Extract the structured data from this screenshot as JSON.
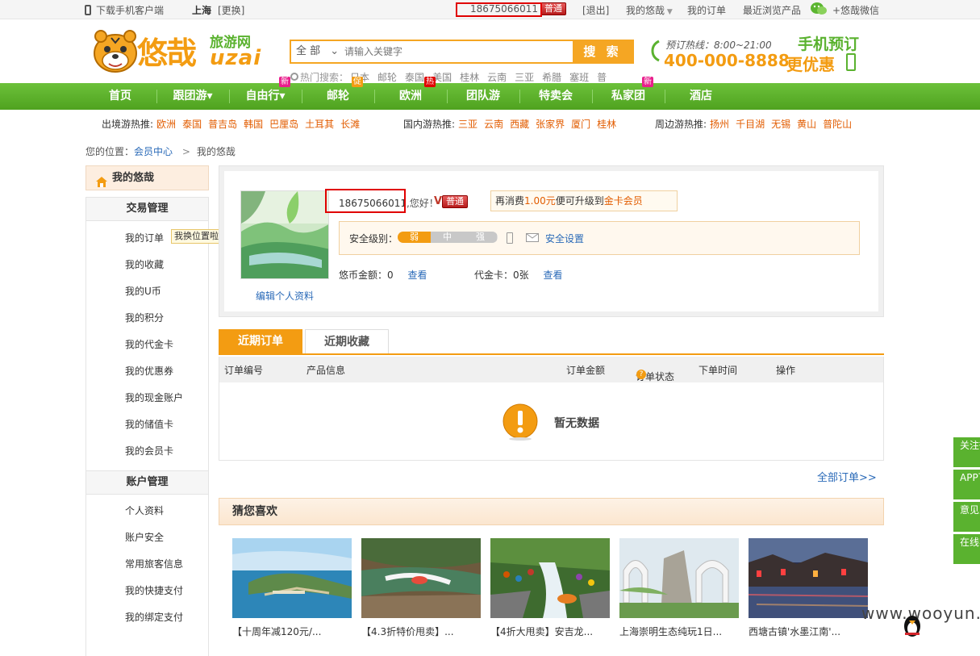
{
  "topbar": {
    "download_app": "下载手机客户端",
    "city": "上海",
    "change_city": "[更换]",
    "username": "18675066011",
    "vip_level": "普通",
    "logout": "[退出]",
    "my_uzai": "我的悠哉",
    "my_orders": "我的订单",
    "recent_viewed": "最近浏览产品",
    "wechat": "+悠哉微信"
  },
  "logo": {
    "cn_name": "悠哉",
    "sub": "旅游网",
    "en": "uzai"
  },
  "search": {
    "category": "全 部",
    "placeholder": "请输入关键字",
    "button": "搜 索",
    "hot_label": "热门搜索：",
    "hot_items": [
      "日本",
      "邮轮",
      "泰国",
      "美国",
      "桂林",
      "云南",
      "三亚",
      "希腊",
      "塞班",
      "普"
    ]
  },
  "hotline": {
    "label": "预订热线：8:00~21:00",
    "number": "400-000-8888"
  },
  "mobile_ad": {
    "line1": "手机预订",
    "line2": "更优惠"
  },
  "nav": {
    "items": [
      {
        "label": "首页"
      },
      {
        "label": "跟团游▾"
      },
      {
        "label": "自由行▾",
        "tag": "新"
      },
      {
        "label": "邮轮",
        "tag": "促"
      },
      {
        "label": "欧洲",
        "tag": "热"
      },
      {
        "label": "团队游"
      },
      {
        "label": "特卖会"
      },
      {
        "label": "私家团",
        "tag": "新"
      },
      {
        "label": "酒店"
      }
    ]
  },
  "recommend": {
    "outbound_label": "出境游热推:",
    "outbound": [
      "欧洲",
      "泰国",
      "普吉岛",
      "韩国",
      "巴厘岛",
      "土耳其",
      "长滩"
    ],
    "domestic_label": "国内游热推:",
    "domestic": [
      "三亚",
      "云南",
      "西藏",
      "张家界",
      "厦门",
      "桂林"
    ],
    "nearby_label": "周边游热推:",
    "nearby": [
      "扬州",
      "千目湖",
      "无锡",
      "黄山",
      "普陀山"
    ]
  },
  "breadcrumb": {
    "prefix": "您的位置：",
    "level1": "会员中心",
    "sep": ">",
    "current": "我的悠哉"
  },
  "sidebar": {
    "home": "我的悠哉",
    "trade_title": "交易管理",
    "trade_items": [
      "我的订单",
      "我的收藏",
      "我的U币",
      "我的积分",
      "我的代金卡",
      "我的优惠券",
      "我的现金账户",
      "我的储值卡",
      "我的会员卡"
    ],
    "account_title": "账户管理",
    "account_items": [
      "个人资料",
      "账户安全",
      "常用旅客信息",
      "我的快捷支付",
      "我的绑定支付"
    ],
    "tooltip": "我换位置啦"
  },
  "profile": {
    "greeting_user": "18675066011",
    "greeting_suffix": ",您好！",
    "vip_level": "普通",
    "upgrade_prefix": "再消费",
    "upgrade_amount": "1.00元",
    "upgrade_mid": "便可升级到",
    "upgrade_target": "金卡会员",
    "security_label": "安全级别：",
    "security_levels": [
      "弱",
      "中",
      "强"
    ],
    "security_current": "弱",
    "security_settings": "安全设置",
    "ucoin_label": "悠币金额：0",
    "ucoin_view": "查看",
    "voucher_label": "代金卡：0张",
    "voucher_view": "查看",
    "edit_profile": "编辑个人资料"
  },
  "orders": {
    "tab_recent_orders": "近期订单",
    "tab_recent_favs": "近期收藏",
    "columns": [
      "订单编号",
      "产品信息",
      "订单金额",
      "订单状态",
      "下单时间",
      "操作"
    ],
    "empty_text": "暂无数据",
    "all_orders": "全部订单>>"
  },
  "guess": {
    "title": "猜您喜欢",
    "products": [
      {
        "caption": "【十周年减120元/..."
      },
      {
        "caption": "【4.3折特价甩卖】..."
      },
      {
        "caption": "【4折大甩卖】安吉龙..."
      },
      {
        "caption": "上海崇明生态纯玩1日..."
      },
      {
        "caption": "西塘古镇'水墨江南'..."
      }
    ]
  },
  "float_bar": {
    "items": [
      "关注微信",
      "APP下载",
      "意见反馈",
      "在线客服"
    ]
  },
  "watermark": "www.wooyun.org",
  "colors": {
    "nav_green": "#5ab22f",
    "orange": "#f39c12",
    "link_blue": "#2a6ab8",
    "hot_orange": "#e25c00"
  }
}
